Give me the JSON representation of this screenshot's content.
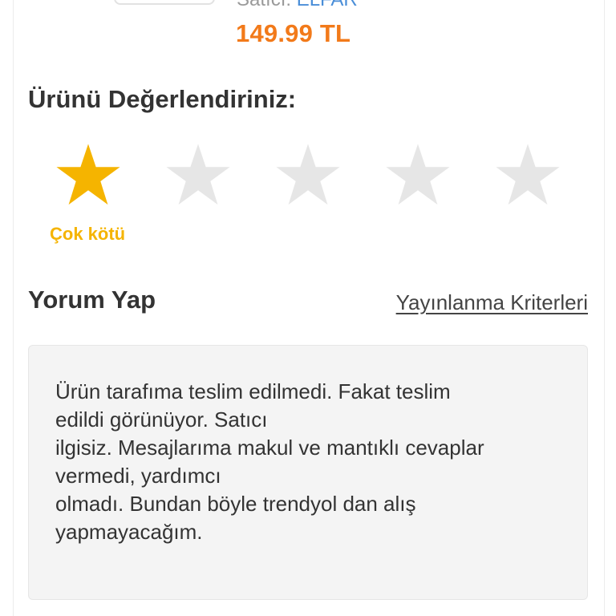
{
  "product": {
    "seller_prefix": "Satıcı:",
    "seller_name": "ELFAR",
    "price": "149.99 TL"
  },
  "rating": {
    "title": "Ürünü Değerlendiriniz:",
    "selected": 1,
    "max": 5,
    "selected_label": "Çok kötü",
    "active_color": "#f5b400",
    "inactive_color": "#e6e6e6"
  },
  "comment": {
    "title": "Yorum Yap",
    "criteria_link": "Yayınlanma Kriterleri",
    "text": "Ürün tarafıma teslim edilmedi. Fakat teslim\nedildi görünüyor. Satıcı\nilgisiz. Mesajlarıma makul ve mantıklı cevaplar\nvermedi, yardımcı\nolmadı. Bundan böyle trendyol dan alış\nyapmayacağım."
  },
  "colors": {
    "price": "#f27a1a",
    "seller_link": "#4a8ed8",
    "heading": "#333333"
  }
}
